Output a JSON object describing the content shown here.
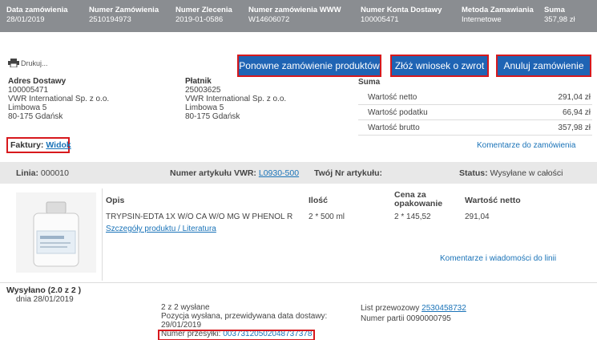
{
  "header": {
    "order_date_label": "Data zamówienia",
    "order_date": "28/01/2019",
    "order_no_label": "Numer Zamówienia",
    "order_no": "2510194973",
    "commission_label": "Numer Zlecenia",
    "commission_no": "2019-01-0586",
    "www_label": "Numer zamówienia WWW",
    "www_no": "W14606072",
    "account_label": "Numer Konta Dostawy",
    "account_no": "100005471",
    "method_label": "Metoda Zamawiania",
    "method": "Internetowe",
    "sum_label": "Suma",
    "sum": "357,98 zł"
  },
  "print_label": "Drukuj...",
  "buttons": {
    "reorder": "Ponowne zamówienie produktów",
    "return": "Złóż wniosek o zwrot",
    "cancel": "Anuluj zamówienie"
  },
  "delivery": {
    "title": "Adres Dostawy",
    "lines": [
      "100005471",
      "VWR International Sp. z o.o.",
      "Limbowa 5",
      "80-175 Gdańsk"
    ]
  },
  "payer": {
    "title": "Płatnik",
    "lines": [
      "25003625",
      "VWR International Sp. z o.o.",
      "Limbowa 5",
      "80-175 Gdańsk"
    ]
  },
  "summary": {
    "title": "Suma",
    "net_label": "Wartość netto",
    "net": "291,04 zł",
    "tax_label": "Wartość podatku",
    "tax": "66,94 zł",
    "gross_label": "Wartość brutto",
    "gross": "357,98 zł"
  },
  "invoices": {
    "label": "Faktury:",
    "link": "Widok"
  },
  "order_comments": "Komentarze do zamówienia",
  "line": {
    "line_label": "Linia:",
    "line_no": "000010",
    "article_label": "Numer artykułu VWR:",
    "article_no": "L0930-500",
    "your_no_label": "Twój Nr artykułu:",
    "status_label": "Status:",
    "status": "Wysyłane w całości"
  },
  "product": {
    "desc_label": "Opis",
    "desc": "TRYPSIN-EDTA 1X W/O CA W/O MG W PHENOL R",
    "details_link": "Szczegóły produktu / Literatura",
    "qty_label": "Ilość",
    "qty": "2 * 500 ml",
    "price_label_1": "Cena za",
    "price_label_2": "opakowanie",
    "price": "2 * 145,52",
    "net_label": "Wartość netto",
    "net": "291,04",
    "line_comments": "Komentarze i wiadomości do linii"
  },
  "shipment": {
    "title": "Wysyłano (2.0 z 2 )",
    "date": "dnia 28/01/2019",
    "sent": "2 z 2 wysłane",
    "position": "Pozycja wysłana,  przewidywana data dostawy:",
    "delivery_date": "29/01/2019",
    "tracking_label": "Numer przesyłki:",
    "tracking_no": "00373120502048737378",
    "waybill_label": "List przewozowy",
    "waybill_no": "2530458732",
    "batch_label": "Numer partii",
    "batch_no": "0090000795"
  },
  "colors": {
    "header_bg": "#8a8d91",
    "button_bg": "#1f64b4",
    "highlight": "#d7191d",
    "link": "#1a73b8"
  }
}
